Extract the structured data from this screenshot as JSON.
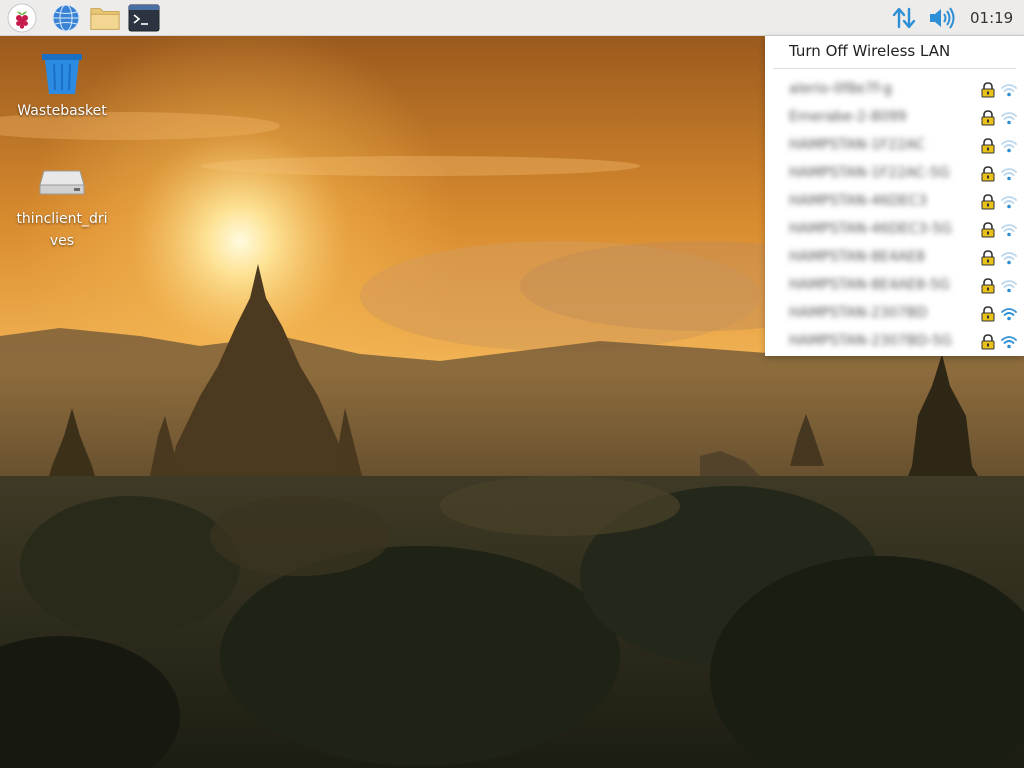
{
  "taskbar": {
    "apps": [
      {
        "name": "raspberry-menu-icon"
      },
      {
        "name": "web-browser-icon"
      },
      {
        "name": "file-manager-icon"
      },
      {
        "name": "terminal-icon"
      }
    ],
    "clock": "01:19"
  },
  "desktop": {
    "icons": [
      {
        "label": "Wastebasket",
        "icon": "wastebasket-icon"
      },
      {
        "label": "thinclient_drives",
        "icon": "drive-icon"
      }
    ]
  },
  "wifi_menu": {
    "toggle_label": "Turn Off Wireless LAN",
    "networks": [
      {
        "ssid": "alerio-0f8e7f-g",
        "secured": true,
        "signal": "weak"
      },
      {
        "ssid": "Emerabe-2-8099",
        "secured": true,
        "signal": "weak"
      },
      {
        "ssid": "HAMPSTAN-1F22AC",
        "secured": true,
        "signal": "weak"
      },
      {
        "ssid": "HAMPSTAN-1F22AC-5G",
        "secured": true,
        "signal": "weak"
      },
      {
        "ssid": "HAMPSTAN-46DEC3",
        "secured": true,
        "signal": "weak"
      },
      {
        "ssid": "HAMPSTAN-46DEC3-5G",
        "secured": true,
        "signal": "weak"
      },
      {
        "ssid": "HAMPSTAN-8E4AE8",
        "secured": true,
        "signal": "weak"
      },
      {
        "ssid": "HAMPSTAN-8E4AE8-5G",
        "secured": true,
        "signal": "weak"
      },
      {
        "ssid": "HAMPSTAN-2307BD",
        "secured": true,
        "signal": "strong"
      },
      {
        "ssid": "HAMPSTAN-2307BD-5G",
        "secured": true,
        "signal": "strong"
      }
    ]
  },
  "colors": {
    "accent": "#2d8fd5",
    "lock": "#e8c21a"
  }
}
